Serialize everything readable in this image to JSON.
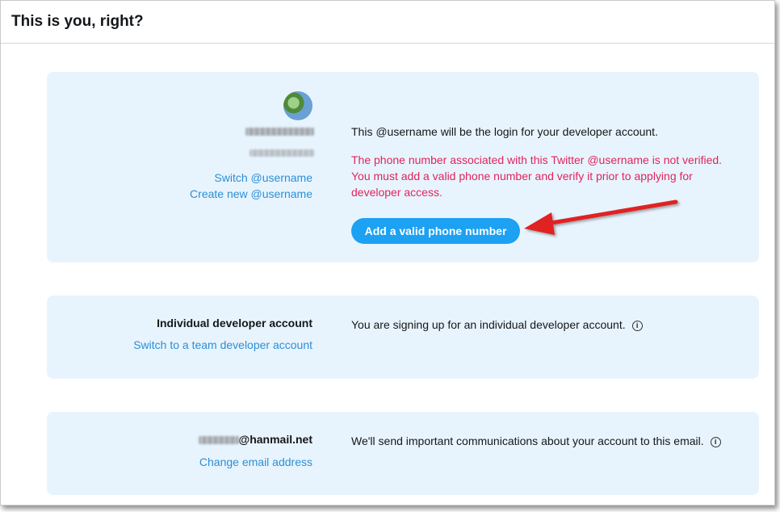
{
  "header": {
    "title": "This is you, right?"
  },
  "account_card": {
    "switch_link": "Switch @username",
    "create_link": "Create new @username",
    "login_text": "This @username will be the login for your developer account.",
    "error_text": "The phone number associated with this Twitter @username is not verified. You must add a valid phone number and verify it prior to applying for developer access.",
    "add_phone_button": "Add a valid phone number",
    "annotation_color": "#e02020"
  },
  "type_card": {
    "title": "Individual developer account",
    "switch_link": "Switch to a team developer account",
    "description": "You are signing up for an individual developer account.",
    "info_icon": "i"
  },
  "email_card": {
    "email_domain": "@hanmail.net",
    "change_link": "Change email address",
    "description": "We'll send important communications about your account to this email.",
    "info_icon": "i"
  },
  "colors": {
    "link": "#2b8fd6",
    "error": "#e0245e",
    "button": "#1da1f2",
    "card": "#e8f4fd"
  }
}
